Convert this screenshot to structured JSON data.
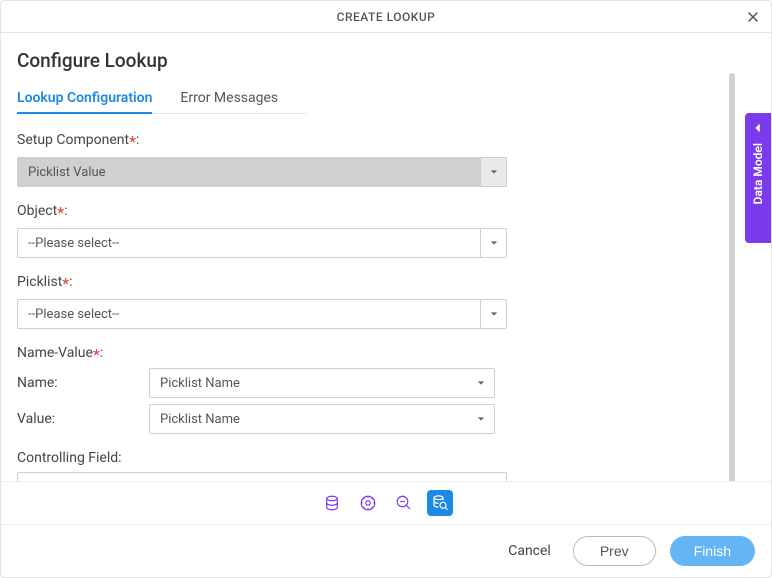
{
  "header": {
    "title": "CREATE LOOKUP"
  },
  "page": {
    "title": "Configure Lookup"
  },
  "tabs": [
    {
      "label": "Lookup Configuration",
      "active": true
    },
    {
      "label": "Error Messages",
      "active": false
    }
  ],
  "fields": {
    "setup_component": {
      "label": "Setup Component",
      "value": "Picklist Value",
      "required": true
    },
    "object": {
      "label": "Object",
      "value": "--Please select--",
      "required": true
    },
    "picklist": {
      "label": "Picklist",
      "value": "--Please select--",
      "required": true
    },
    "name_value": {
      "label": "Name-Value",
      "required": true,
      "name_label": "Name:",
      "name_value": "Picklist Name",
      "value_label": "Value:",
      "value_value": "Picklist Name"
    },
    "controlling_field": {
      "label": "Controlling Field:",
      "value": ""
    }
  },
  "side_tab": {
    "label": "Data Model"
  },
  "footer": {
    "cancel": "Cancel",
    "prev": "Prev",
    "finish": "Finish"
  }
}
